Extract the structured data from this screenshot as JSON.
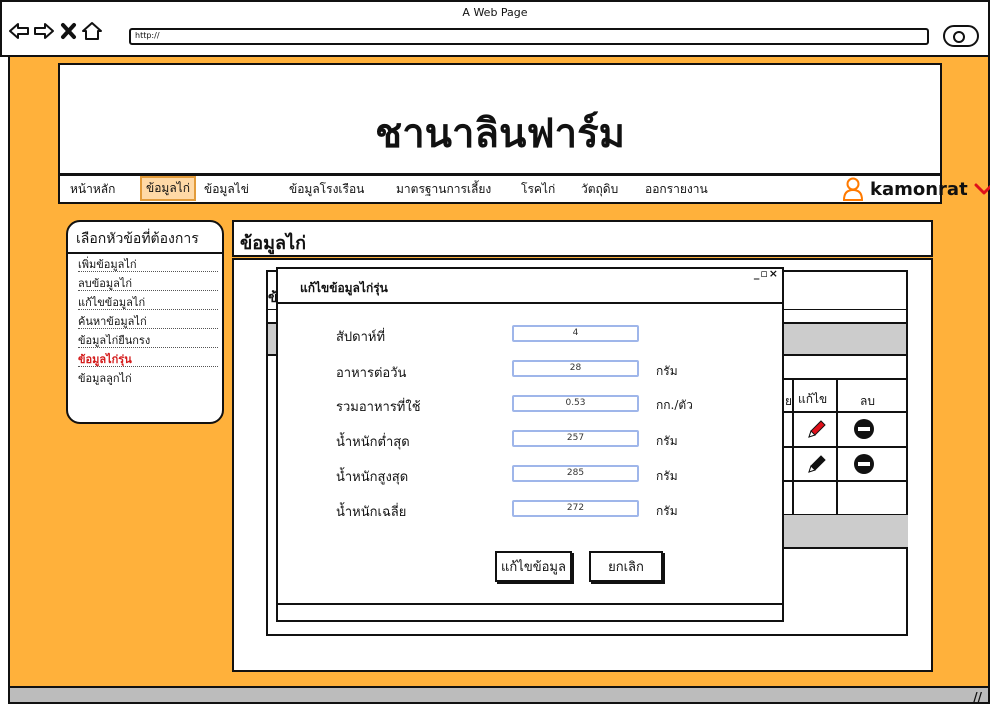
{
  "browser": {
    "window_title": "A Web Page",
    "url": "http://"
  },
  "site": {
    "title": "ชานาลินฟาร์ม"
  },
  "nav": {
    "items": [
      {
        "label": "หน้าหลัก"
      },
      {
        "label": "ข้อมูลไก่"
      },
      {
        "label": "ข้อมูลไข่"
      },
      {
        "label": "ข้อมูลโรงเรือน"
      },
      {
        "label": "มาตรฐานการเลี้ยง"
      },
      {
        "label": "โรคไก่"
      },
      {
        "label": "วัตถุดิบ"
      },
      {
        "label": "ออกรายงาน"
      }
    ],
    "active_index": 1,
    "user_name": "kamonrat",
    "accent": "#ff7a00",
    "chevron_color": "#e0101a"
  },
  "sidebar": {
    "title": "เลือกหัวข้อที่ต้องการ",
    "items": [
      {
        "label": "เพิ่มข้อมูลไก่"
      },
      {
        "label": "ลบข้อมูลไก่"
      },
      {
        "label": "แก้ไขข้อมูลไก่"
      },
      {
        "label": "ค้นหาข้อมูลไก่"
      },
      {
        "label": "ข้อมูลไก่ยืนกรง"
      },
      {
        "label": "ข้อมูลไก่รุ่น"
      },
      {
        "label": "ข้อมูลลูกไก่"
      }
    ],
    "active_index": 5
  },
  "content": {
    "title": "ข้อมูลไก่",
    "partial_char": "ข้",
    "table_headers": {
      "edit": "แก้ไข",
      "delete": "ลบ",
      "partial": "ย"
    }
  },
  "dialog": {
    "title": "แก้ไขข้อมูลไก่รุ่น",
    "controls": "_▫×",
    "fields": [
      {
        "label": "สัปดาห์ที่",
        "value": "4",
        "unit": ""
      },
      {
        "label": "อาหารต่อวัน",
        "value": "28",
        "unit": "กรัม"
      },
      {
        "label": "รวมอาหารที่ใช้",
        "value": "0.53",
        "unit": "กก./ตัว"
      },
      {
        "label": "น้ำหนักต่ำสุด",
        "value": "257",
        "unit": "กรัม"
      },
      {
        "label": "น้ำหนักสูงสุด",
        "value": "285",
        "unit": "กรัม"
      },
      {
        "label": "น้ำหนักเฉลี่ย",
        "value": "272",
        "unit": "กรัม"
      }
    ],
    "save_label": "แก้ไขข้อมูล",
    "cancel_label": "ยกเลิก"
  },
  "colors": {
    "page_bg": "#ffb13b",
    "active_nav_bg": "#ffd9a6",
    "input_border": "#9fb6ea",
    "active_side": "#d41b1b",
    "edit_pencil": "#e0101a"
  }
}
